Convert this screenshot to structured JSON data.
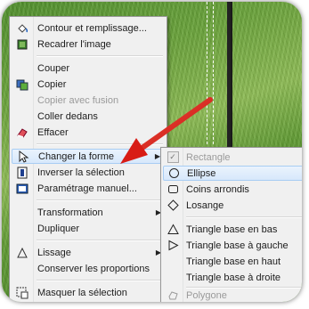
{
  "menu": {
    "items": [
      {
        "label": "Contour et remplissage...",
        "icon": "paint-bucket-icon",
        "disabled": false
      },
      {
        "label": "Recadrer l'image",
        "icon": "crop-icon",
        "disabled": false
      },
      {
        "label": "Couper",
        "icon": "",
        "disabled": false
      },
      {
        "label": "Copier",
        "icon": "copy-icon",
        "disabled": false
      },
      {
        "label": "Copier avec fusion",
        "icon": "",
        "disabled": true
      },
      {
        "label": "Coller dedans",
        "icon": "",
        "disabled": false
      },
      {
        "label": "Effacer",
        "icon": "eraser-icon",
        "disabled": false
      },
      {
        "label": "Changer la forme",
        "icon": "pointer-icon",
        "disabled": false,
        "highlighted": true,
        "submenu": true
      },
      {
        "label": "Inverser la sélection",
        "icon": "invert-selection-icon",
        "disabled": false
      },
      {
        "label": "Paramétrage manuel...",
        "icon": "manual-settings-icon",
        "disabled": false
      },
      {
        "label": "Transformation",
        "icon": "",
        "disabled": false,
        "submenu": true
      },
      {
        "label": "Dupliquer",
        "icon": "",
        "disabled": false
      },
      {
        "label": "Lissage",
        "icon": "smoothing-icon",
        "disabled": false,
        "submenu": true
      },
      {
        "label": "Conserver les proportions",
        "icon": "",
        "disabled": false
      },
      {
        "label": "Masquer la sélection",
        "icon": "hide-selection-icon",
        "disabled": false
      }
    ]
  },
  "submenu": {
    "items": [
      {
        "label": "Rectangle",
        "icon": "checkmark-icon",
        "disabled": true
      },
      {
        "label": "Ellipse",
        "icon": "ellipse-icon",
        "disabled": false,
        "highlighted": true
      },
      {
        "label": "Coins arrondis",
        "icon": "rounded-rect-icon",
        "disabled": false
      },
      {
        "label": "Losange",
        "icon": "diamond-icon",
        "disabled": false
      },
      {
        "label": "Triangle base en bas",
        "icon": "triangle-up-icon",
        "disabled": false
      },
      {
        "label": "Triangle base à gauche",
        "icon": "triangle-right-icon",
        "disabled": false
      },
      {
        "label": "Triangle base en haut",
        "icon": "",
        "disabled": false
      },
      {
        "label": "Triangle base à droite",
        "icon": "",
        "disabled": false
      },
      {
        "label": "Polygone",
        "icon": "polygon-icon",
        "disabled": true
      }
    ]
  },
  "colors": {
    "highlight": "#d7e8fb",
    "highlight_border": "#a8cdf3",
    "arrow": "#e3221c",
    "disabled_text": "#9a9a9a"
  }
}
